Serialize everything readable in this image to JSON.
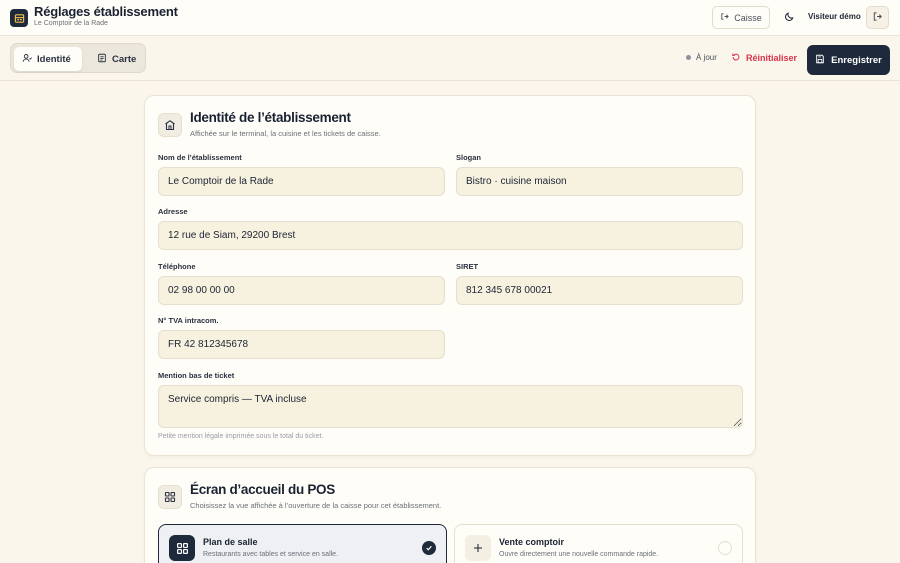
{
  "header": {
    "title": "Réglages établissement",
    "subtitle": "Le Comptoir de la Rade",
    "caisse_label": "Caisse",
    "user_name": "Visiteur démo"
  },
  "toolbar": {
    "tabs": [
      {
        "label": "Identité",
        "icon": "user-icon",
        "active": true
      },
      {
        "label": "Carte",
        "icon": "document-icon",
        "active": false
      }
    ],
    "status_label": "À jour",
    "reset_label": "Réinitialiser",
    "save_label": "Enregistrer"
  },
  "identity": {
    "title": "Identité de l’établissement",
    "description": "Affichée sur le terminal, la cuisine et les tickets de caisse.",
    "fields": {
      "name": {
        "label": "Nom de l’établissement",
        "value": "Le Comptoir de la Rade"
      },
      "slogan": {
        "label": "Slogan",
        "value": "Bistro · cuisine maison"
      },
      "address": {
        "label": "Adresse",
        "value": "12 rue de Siam, 29200 Brest"
      },
      "phone": {
        "label": "Téléphone",
        "value": "02 98 00 00 00"
      },
      "siret": {
        "label": "SIRET",
        "value": "812 345 678 00021"
      },
      "vat": {
        "label": "N° TVA intracom.",
        "value": "FR 42 812345678"
      },
      "footer": {
        "label": "Mention bas de ticket",
        "value": "Service compris — TVA incluse",
        "help": "Petite mention légale imprimée sous le total du ticket."
      }
    }
  },
  "pos_home": {
    "title": "Écran d’accueil du POS",
    "description": "Choisissez la vue affichée à l’ouverture de la caisse pour cet établissement.",
    "options": [
      {
        "title": "Plan de salle",
        "description": "Restaurants avec tables et service en salle.",
        "selected": true
      },
      {
        "title": "Vente comptoir",
        "description": "Ouvre directement une nouvelle commande rapide.",
        "selected": false
      }
    ]
  },
  "colors": {
    "primary": "#1e2a3b",
    "danger": "#d6344a",
    "background": "#faf6ec",
    "input_bg": "#f7f1e0"
  }
}
